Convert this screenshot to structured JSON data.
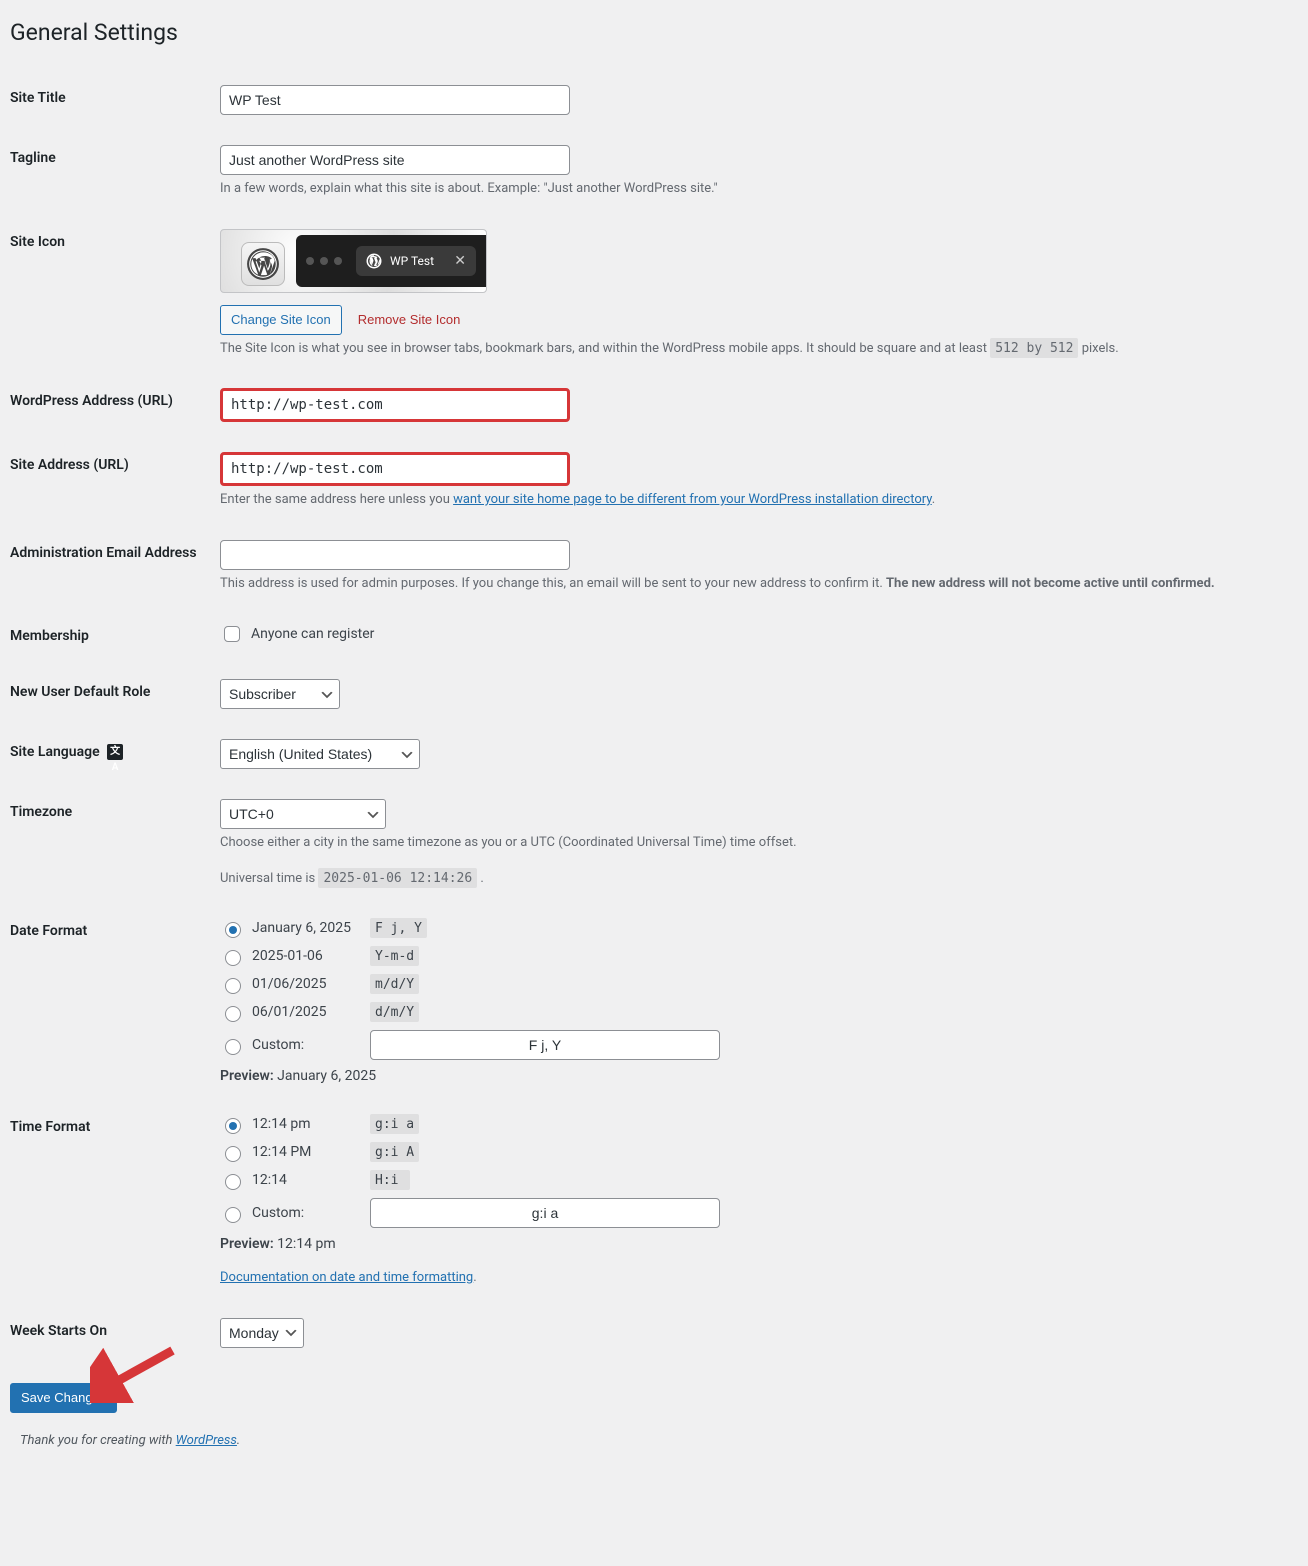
{
  "page": {
    "title": "General Settings"
  },
  "fields": {
    "site_title": {
      "label": "Site Title",
      "value": "WP Test"
    },
    "tagline": {
      "label": "Tagline",
      "value": "Just another WordPress site",
      "desc": "In a few words, explain what this site is about. Example: \"Just another WordPress site.\""
    },
    "site_icon": {
      "label": "Site Icon",
      "tab_title": "WP Test",
      "change_btn": "Change Site Icon",
      "remove_btn": "Remove Site Icon",
      "desc_prefix": "The Site Icon is what you see in browser tabs, bookmark bars, and within the WordPress mobile apps. It should be square and at least ",
      "desc_code": "512 by 512",
      "desc_suffix": " pixels."
    },
    "wp_url": {
      "label": "WordPress Address (URL)",
      "value": "http://wp-test.com"
    },
    "site_url": {
      "label": "Site Address (URL)",
      "value": "http://wp-test.com",
      "desc_prefix": "Enter the same address here unless you ",
      "desc_link": "want your site home page to be different from your WordPress installation directory",
      "desc_suffix": "."
    },
    "admin_email": {
      "label": "Administration Email Address",
      "value": "",
      "desc_prefix": "This address is used for admin purposes. If you change this, an email will be sent to your new address to confirm it. ",
      "desc_bold": "The new address will not become active until confirmed."
    },
    "membership": {
      "label": "Membership",
      "checkbox_label": "Anyone can register",
      "checked": false
    },
    "default_role": {
      "label": "New User Default Role",
      "value": "Subscriber"
    },
    "site_language": {
      "label": "Site Language",
      "value": "English (United States)"
    },
    "timezone": {
      "label": "Timezone",
      "value": "UTC+0",
      "desc": "Choose either a city in the same timezone as you or a UTC (Coordinated Universal Time) time offset.",
      "universal_prefix": "Universal time is ",
      "universal_code": "2025-01-06 12:14:26",
      "universal_suffix": " ."
    },
    "date_format": {
      "label": "Date Format",
      "options": [
        {
          "label": "January 6, 2025",
          "code": "F j, Y",
          "selected": true
        },
        {
          "label": "2025-01-06",
          "code": "Y-m-d",
          "selected": false
        },
        {
          "label": "01/06/2025",
          "code": "m/d/Y",
          "selected": false
        },
        {
          "label": "06/01/2025",
          "code": "d/m/Y",
          "selected": false
        }
      ],
      "custom_label": "Custom:",
      "custom_value": "F j, Y",
      "preview_label": "Preview:",
      "preview_value": "January 6, 2025"
    },
    "time_format": {
      "label": "Time Format",
      "options": [
        {
          "label": "12:14 pm",
          "code": "g:i a",
          "selected": true
        },
        {
          "label": "12:14 PM",
          "code": "g:i A",
          "selected": false
        },
        {
          "label": "12:14",
          "code": "H:i",
          "selected": false
        }
      ],
      "custom_label": "Custom:",
      "custom_value": "g:i a",
      "preview_label": "Preview:",
      "preview_value": "12:14 pm",
      "doc_link": "Documentation on date and time formatting",
      "doc_suffix": "."
    },
    "week_starts": {
      "label": "Week Starts On",
      "value": "Monday"
    }
  },
  "submit": {
    "label": "Save Changes"
  },
  "footer": {
    "prefix": "Thank you for creating with ",
    "link": "WordPress",
    "suffix": "."
  }
}
